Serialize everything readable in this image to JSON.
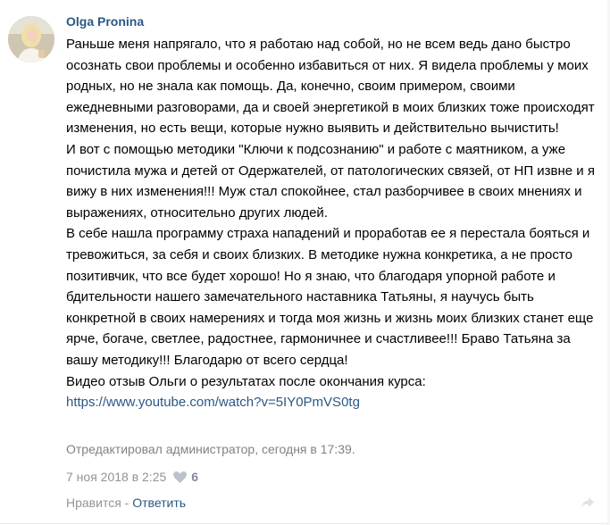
{
  "comment": {
    "author": "Olga Pronina",
    "paragraphs": [
      "Раньше меня напрягало, что я работаю над собой, но не всем ведь дано быстро осознать свои проблемы и особенно избавиться от них. Я видела проблемы у моих родных, но не знала как помощь. Да, конечно, своим примером, своими ежедневными разговорами, да и своей энергетикой в моих близких тоже происходят изменения, но есть вещи, которые нужно выявить и действительно вычистить!",
      "И вот с помощью методики \"Ключи к подсознанию\" и работе с маятником, а уже почистила мужа и детей от Одержателей, от патологических связей, от НП извне и я вижу в них изменения!!! Муж стал спокойнее, стал разборчивее в своих мнениях и выражениях, относительно других людей.",
      "В себе нашла программу страха нападений и проработав ее я перестала бояться и тревожиться, за себя и своих близких. В методике нужна конкретика, а не просто позитивчик, что все будет хорошо! Но я знаю, что благодаря упорной работе и бдительности нашего замечательного наставника Татьяны, я научусь быть конкретной в своих намерениях и тогда моя жизнь и жизнь моих близких станет еще ярче, богаче, светлее, радостнее, гармоничнее и счастливее!!! Браво Татьяна за вашу методику!!! Благодарю от всего сердца!",
      "Видео отзыв Ольги о результатах после окончания курса:"
    ],
    "link": "https://www.youtube.com/watch?v=5IY0PmVS0tg",
    "edited_note": "Отредактировал администратор, сегодня в 17:39.",
    "date": "7 ноя 2018 в 2:25",
    "like_count": "6",
    "like_label": "Нравится",
    "separator": " - ",
    "reply_label": "Ответить",
    "colors": {
      "link": "#2a5885",
      "muted": "#939393"
    },
    "icons": {
      "likes": "heart-icon",
      "menu": "share-icon"
    }
  }
}
